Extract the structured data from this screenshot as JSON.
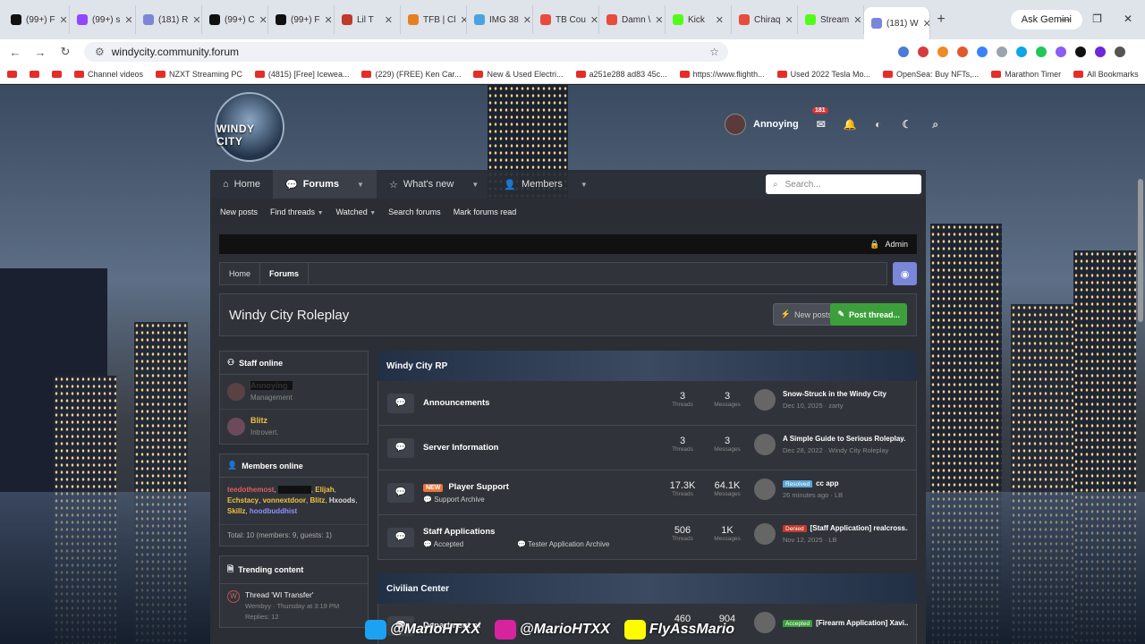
{
  "browser": {
    "tabs": [
      {
        "label": "(99+) F",
        "color": "#111"
      },
      {
        "label": "(99+) s",
        "color": "#9146ff"
      },
      {
        "label": "(181) R",
        "color": "#7a86d8"
      },
      {
        "label": "(99+) C",
        "color": "#111"
      },
      {
        "label": "(99+) F",
        "color": "#111"
      },
      {
        "label": "Lil T",
        "color": "#c0392b"
      },
      {
        "label": "TFB | Cl",
        "color": "#e67e22"
      },
      {
        "label": "IMG 38",
        "color": "#4aa3df"
      },
      {
        "label": "TB Cou",
        "color": "#e74c3c"
      },
      {
        "label": "Damn \\",
        "color": "#e74c3c"
      },
      {
        "label": "Kick",
        "color": "#53fc18"
      },
      {
        "label": "Chiraq",
        "color": "#e74c3c"
      },
      {
        "label": "Stream",
        "color": "#53fc18"
      },
      {
        "label": "(181) W",
        "color": "#7a86d8"
      }
    ],
    "gemini_label": "Ask Gemini",
    "url": "windycity.community.forum",
    "bookmarks": [
      "Channel videos",
      "NZXT Streaming PC",
      "(4815) [Free] Icewea...",
      "(229) (FREE) Ken Car...",
      "New & Used Electri...",
      "a251e288 ad83 45c...",
      "https://www.flighth...",
      "Used 2022 Tesla Mo...",
      "OpenSea: Buy NFTs,...",
      "Marathon Timer",
      "All Bookmarks"
    ]
  },
  "site": {
    "logo_text": "WINDY CITY",
    "user": {
      "name": "Annoying",
      "inbox_count": "181"
    },
    "nav": {
      "home": "Home",
      "forums": "Forums",
      "whats_new": "What's new",
      "members": "Members",
      "search_placeholder": "Search..."
    },
    "subnav": [
      "New posts",
      "Find threads",
      "Watched",
      "Search forums",
      "Mark forums read"
    ],
    "admin_label": "Admin",
    "breadcrumb": {
      "home": "Home",
      "current": "Forums"
    },
    "page_title": "Windy City Roleplay",
    "btn_new_posts": "New posts",
    "btn_post_thread": "Post thread..."
  },
  "sidebar": {
    "staff_title": "Staff online",
    "staff": [
      {
        "name": "Annoying",
        "role": "Management"
      },
      {
        "name": "Blitz",
        "role": "Introvert."
      }
    ],
    "members_title": "Members online",
    "members": [
      {
        "name": "teedothemost",
        "color": "#e05c5c"
      },
      {
        "name": "Annoying",
        "color": "#111"
      },
      {
        "name": "Elijah",
        "color": "#f0c040"
      },
      {
        "name": "Echstacy",
        "color": "#f0c040"
      },
      {
        "name": "vonnextdoor",
        "color": "#f0c040"
      },
      {
        "name": "Blitz",
        "color": "#f0c040"
      },
      {
        "name": "Hxoods",
        "color": "#ddd"
      },
      {
        "name": "Skillz",
        "color": "#f0c040"
      },
      {
        "name": "hoodbuddhist",
        "color": "#8f8fff"
      }
    ],
    "members_total": "Total: 10 (members: 9, guests: 1)",
    "trending_title": "Trending content",
    "trending": {
      "title": "Thread 'WI Transfer'",
      "meta": "Wembyy · Thursday at 3:19 PM",
      "replies": "Replies: 12"
    }
  },
  "forums": {
    "cat1": "Windy City RP",
    "rows": [
      {
        "title": "Announcements",
        "sub": "",
        "sub2": "",
        "threads": "3",
        "messages": "3",
        "latest_title": "Snow-Struck in the Windy City",
        "latest_meta": "Dec 10, 2025 · zarty",
        "tag": "",
        "tag_color": ""
      },
      {
        "title": "Server Information",
        "sub": "",
        "sub2": "",
        "threads": "3",
        "messages": "3",
        "latest_title": "A Simple Guide to Serious Roleplay.",
        "latest_meta": "Dec 28, 2022 · Windy City Roleplay",
        "tag": "",
        "tag_color": ""
      },
      {
        "title": "Player Support",
        "sub": "Support Archive",
        "sub2": "",
        "threads": "17.3K",
        "messages": "64.1K",
        "latest_title": "cc app",
        "latest_meta": "26 minutes ago · LB",
        "tag": "Resolved",
        "tag_color": "#5aa6d6",
        "new": "NEW"
      },
      {
        "title": "Staff Applications",
        "sub": "Accepted",
        "sub2": "Tester Application Archive",
        "threads": "506",
        "messages": "1K",
        "latest_title": "[Staff Application] realcross...",
        "latest_meta": "Nov 12, 2025 · LB",
        "tag": "Denied",
        "tag_color": "#c0392b"
      }
    ],
    "threads_label": "Threads",
    "messages_label": "Messages",
    "cat2": "Civilian Center",
    "partial_row": {
      "title": "Department of",
      "threads": "460",
      "messages": "904",
      "latest_title": "[Firearm Application] Xavi...",
      "tag": "Accepted",
      "tag_color": "#3c9f3c"
    }
  },
  "overlay": {
    "twitter": "@MarioHTXX",
    "instagram": "@MarioHTXX",
    "snapchat": "FlyAssMario"
  }
}
